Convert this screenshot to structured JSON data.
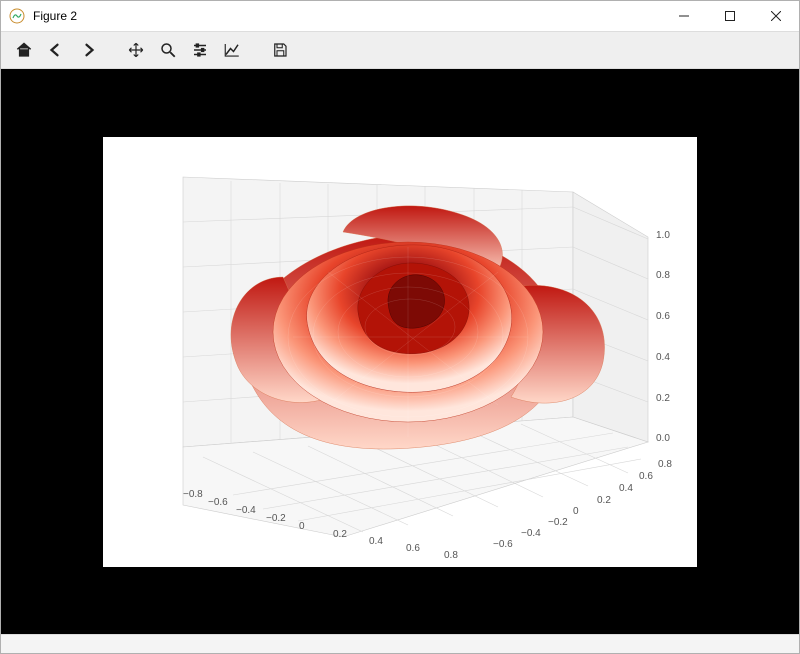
{
  "window": {
    "title": "Figure 2"
  },
  "toolbar": {
    "home": "home-icon",
    "back": "back-icon",
    "forward": "forward-icon",
    "pan": "pan-icon",
    "zoom": "zoom-icon",
    "subplots": "subplots-icon",
    "axes": "axes-icon",
    "save": "save-icon"
  },
  "chart_data": {
    "type": "surface3d",
    "description": "3D parametric surface shaped like a rose, colored with a red gradient",
    "colormap": "Reds",
    "x_ticks": [
      -0.8,
      -0.6,
      -0.4,
      -0.2,
      0.0,
      0.2,
      0.4,
      0.6,
      0.8
    ],
    "y_ticks": [
      -0.6,
      -0.4,
      -0.2,
      0.0,
      0.2,
      0.4,
      0.6,
      0.8
    ],
    "z_ticks": [
      0.0,
      0.2,
      0.4,
      0.6,
      0.8,
      1.0
    ],
    "xlim": [
      -0.9,
      0.9
    ],
    "ylim": [
      -0.7,
      0.9
    ],
    "zlim": [
      0.0,
      1.0
    ],
    "title": "",
    "xlabel": "",
    "ylabel": "",
    "zlabel": "",
    "grid": true,
    "surface_colors": {
      "low": "#fff0ea",
      "mid": "#f36a4a",
      "high": "#7a0a0a"
    }
  }
}
